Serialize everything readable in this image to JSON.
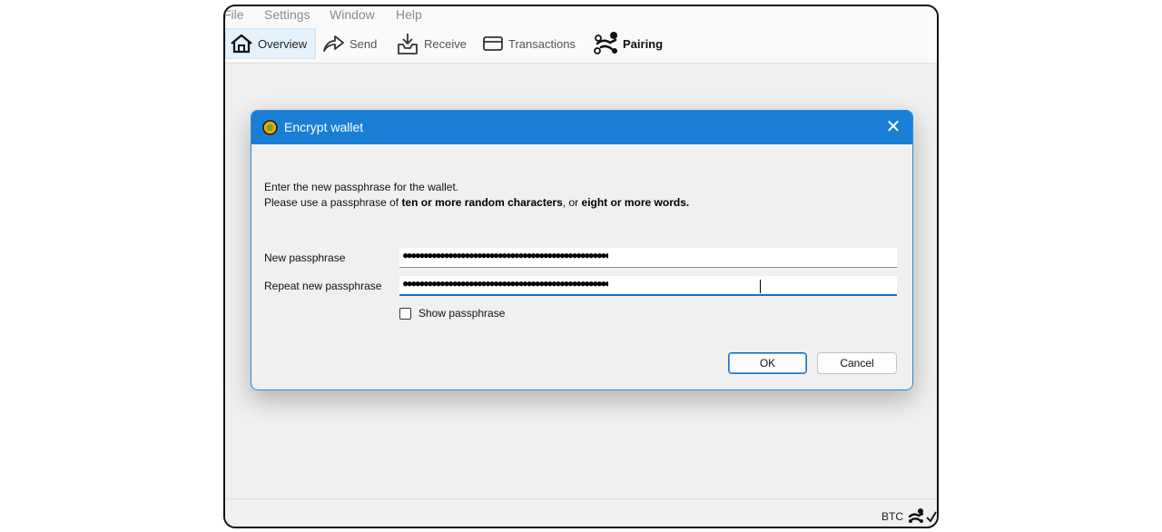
{
  "menu": [
    "File",
    "Settings",
    "Window",
    "Help"
  ],
  "toolbar": {
    "overview": "Overview",
    "send": "Send",
    "receive": "Receive",
    "transactions": "Transactions",
    "pairing": "Pairing"
  },
  "status": {
    "unit": "BTC"
  },
  "dialog": {
    "title": "Encrypt wallet",
    "line1": "Enter the new passphrase for the wallet.",
    "line2_a": "Please use a passphrase of ",
    "line2_b": "ten or more random characters",
    "line2_c": ", or ",
    "line2_d": "eight or more words",
    "line2_e": ".",
    "new_label": "New passphrase",
    "new_value": "●●●●●●●●●●●●●●●●●●●●●●●●●●●●●●●●●●●●●●●●●●●●●●●●●●",
    "repeat_label": "Repeat new passphrase",
    "repeat_value": "●●●●●●●●●●●●●●●●●●●●●●●●●●●●●●●●●●●●●●●●●●●●●●●●●●",
    "show_label": "Show passphrase",
    "show_checked": false,
    "ok": "OK",
    "cancel": "Cancel"
  },
  "colors": {
    "titlebar": "#1a7fd4",
    "accent": "#2a8ad8",
    "coin": "#f2a900"
  }
}
